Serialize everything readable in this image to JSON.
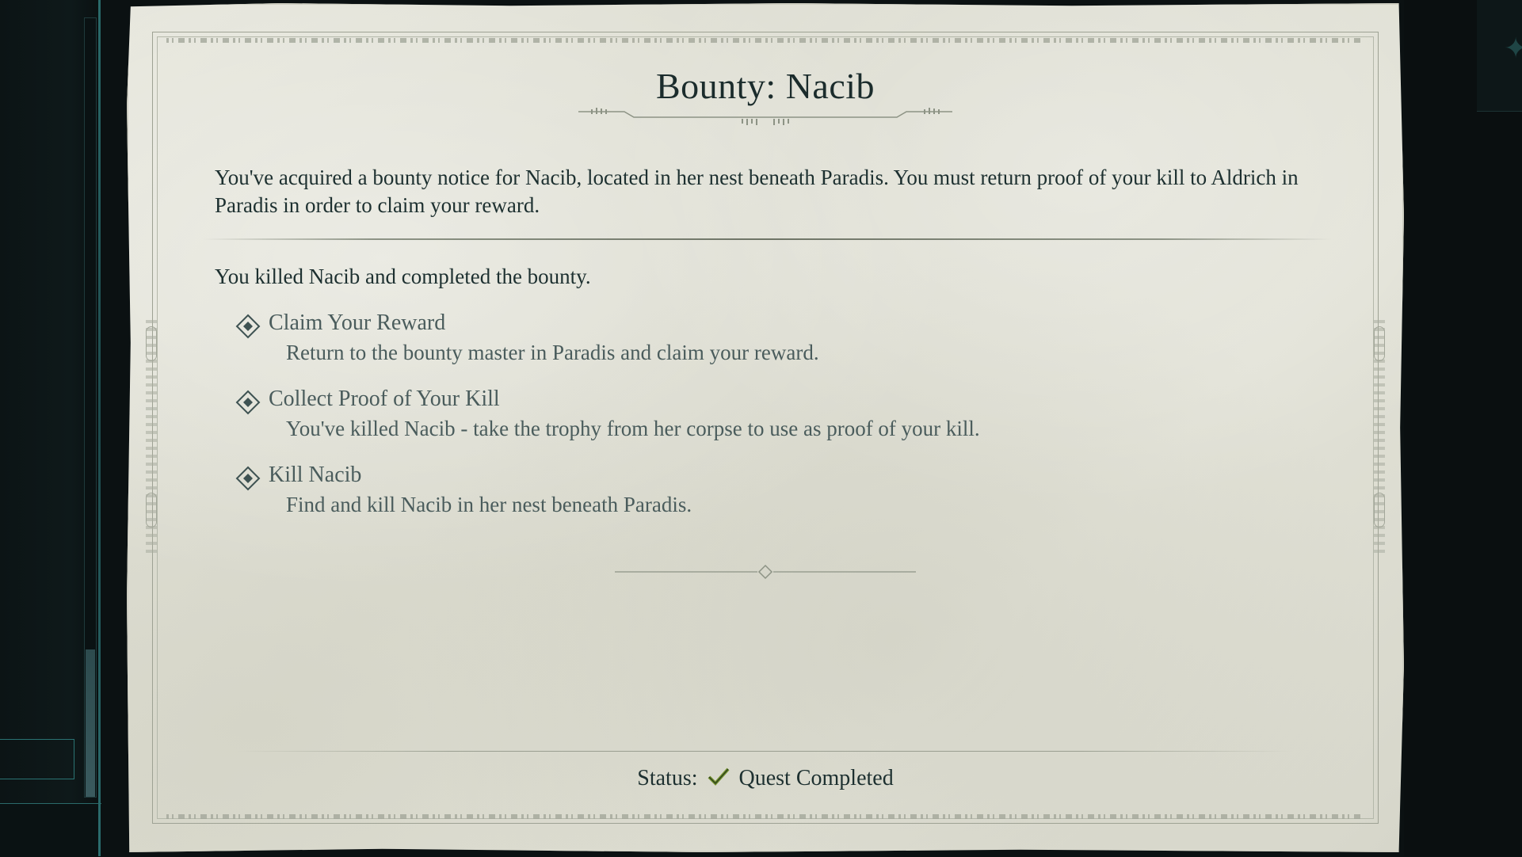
{
  "bounty": {
    "title": "Bounty: Nacib",
    "intro": "You've acquired a bounty notice for Nacib, located in her nest beneath Paradis. You must return proof of your kill to Aldrich in Paradis in order to claim your reward.",
    "summary": "You killed Nacib and completed the bounty."
  },
  "objectives": [
    {
      "title": "Claim Your Reward",
      "desc": "Return to the bounty master in Paradis and claim your reward.",
      "icon": "diamond-objective-icon"
    },
    {
      "title": "Collect Proof of Your Kill",
      "desc": "You've killed Nacib - take the trophy from her corpse to use as proof of your kill.",
      "icon": "diamond-objective-icon"
    },
    {
      "title": "Kill Nacib",
      "desc": "Find and kill Nacib in her nest beneath Paradis.",
      "icon": "diamond-objective-icon"
    }
  ],
  "status": {
    "label": "Status:",
    "value": "Quest Completed",
    "icon": "check-icon",
    "icon_color": "#6f8d2a"
  },
  "colors": {
    "parchment": "#e2e2d7",
    "ink": "#1d3030",
    "muted_ink": "#4a5c5c",
    "accent_teal": "#2a7373"
  }
}
